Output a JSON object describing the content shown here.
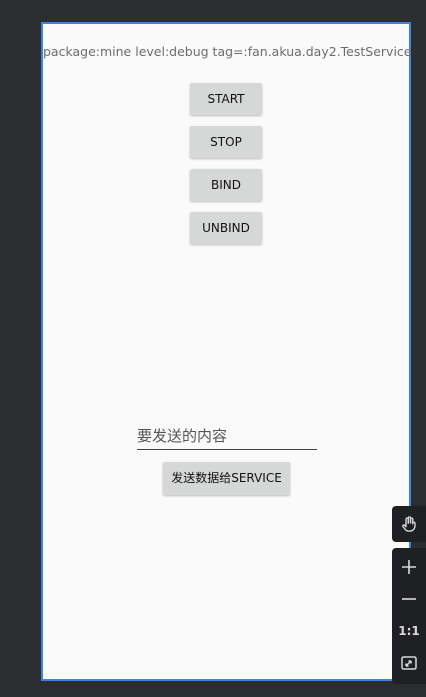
{
  "log_line": "package:mine level:debug tag=:fan.akua.day2.TestService",
  "buttons": {
    "start": "START",
    "stop": "STOP",
    "bind": "BIND",
    "unbind": "UNBIND",
    "send": "发送数据给SERVICE"
  },
  "message_input": {
    "placeholder": "要发送的内容",
    "value": ""
  },
  "toolbar": {
    "actual_size_label": "1:1",
    "icons": [
      "hand-icon",
      "plus-icon",
      "minus-icon",
      "actual-size-icon",
      "fit-screen-icon"
    ]
  },
  "colors": {
    "background": "#2b2d30",
    "device_screen": "#fafafa",
    "device_border": "#3d86e0",
    "button": "#d6d7d7",
    "toolbar": "#1f2023"
  }
}
